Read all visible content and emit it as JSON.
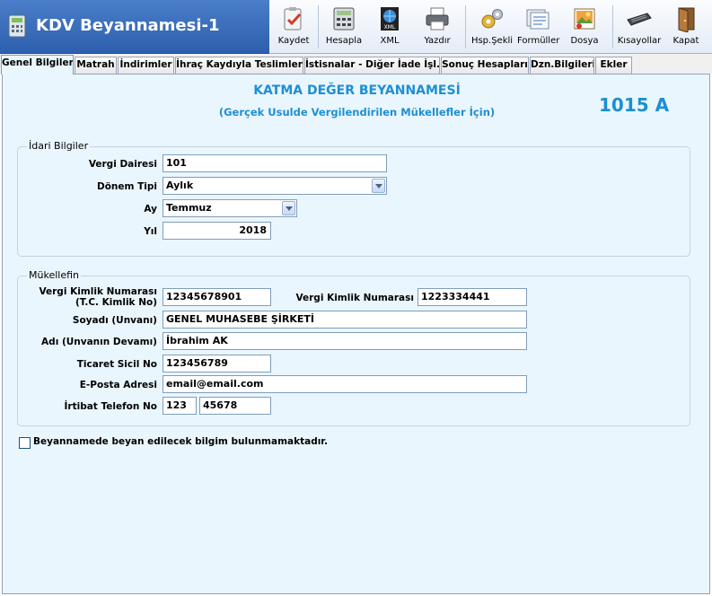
{
  "window": {
    "title": "KDV Beyannamesi-1"
  },
  "toolbar": {
    "buttons": [
      {
        "label": "Kaydet",
        "icon": "clipboard-check-icon"
      },
      {
        "label": "Hesapla",
        "icon": "calculator-icon"
      },
      {
        "label": "XML",
        "icon": "xml-globe-icon"
      },
      {
        "label": "Yazdır",
        "icon": "printer-icon"
      },
      {
        "label": "Hsp.Şekli",
        "icon": "gears-icon"
      },
      {
        "label": "Formüller",
        "icon": "forms-icon"
      },
      {
        "label": "Dosya",
        "icon": "image-file-icon"
      },
      {
        "label": "Kısayollar",
        "icon": "keyboard-icon"
      },
      {
        "label": "Kapat",
        "icon": "exit-door-icon"
      }
    ]
  },
  "tabs": [
    {
      "label": "Genel Bilgiler",
      "active": true
    },
    {
      "label": "Matrah"
    },
    {
      "label": "İndirimler"
    },
    {
      "label": "İhraç Kaydıyla Teslimler"
    },
    {
      "label": "İstisnalar - Diğer İade İşl."
    },
    {
      "label": "Sonuç Hesapları"
    },
    {
      "label": "Dzn.Bilgileri"
    },
    {
      "label": "Ekler"
    }
  ],
  "header": {
    "title": "KATMA DEĞER BEYANNAMESİ",
    "subtitle": "(Gerçek Usulde Vergilendirilen Mükellefler İçin)",
    "form_code": "1015 A"
  },
  "idari": {
    "legend": "İdari Bilgiler",
    "vergi_dairesi_label": "Vergi Dairesi",
    "vergi_dairesi_value": "101",
    "donem_tipi_label": "Dönem Tipi",
    "donem_tipi_value": "Aylık",
    "ay_label": "Ay",
    "ay_value": "Temmuz",
    "yil_label": "Yıl",
    "yil_value": "2018"
  },
  "mukellef": {
    "legend": "Mükellefin",
    "vkn_tc_label_1": "Vergi Kimlik Numarası",
    "vkn_tc_label_2": "(T.C. Kimlik No)",
    "vkn_tc_value": "12345678901",
    "vkn_label": "Vergi Kimlik Numarası",
    "vkn_value": "1223334441",
    "soyadi_label": "Soyadı (Unvanı)",
    "soyadi_value": "GENEL MUHASEBE ŞİRKETİ",
    "adi_label": "Adı (Unvanın Devamı)",
    "adi_value": "İbrahim AK",
    "ticaret_label": "Ticaret Sicil No",
    "ticaret_value": "123456789",
    "eposta_label": "E-Posta Adresi",
    "eposta_value": "email@email.com",
    "telefon_label": "İrtibat Telefon No",
    "telefon_kod": "123",
    "telefon_no": "45678"
  },
  "checkbox": {
    "label": "Beyannamede beyan edilecek bilgim bulunmamaktadır.",
    "checked": false
  },
  "colors": {
    "accent": "#1d8fd3",
    "panel": "#eaf6fd",
    "titlebar": "#2d5fae"
  }
}
